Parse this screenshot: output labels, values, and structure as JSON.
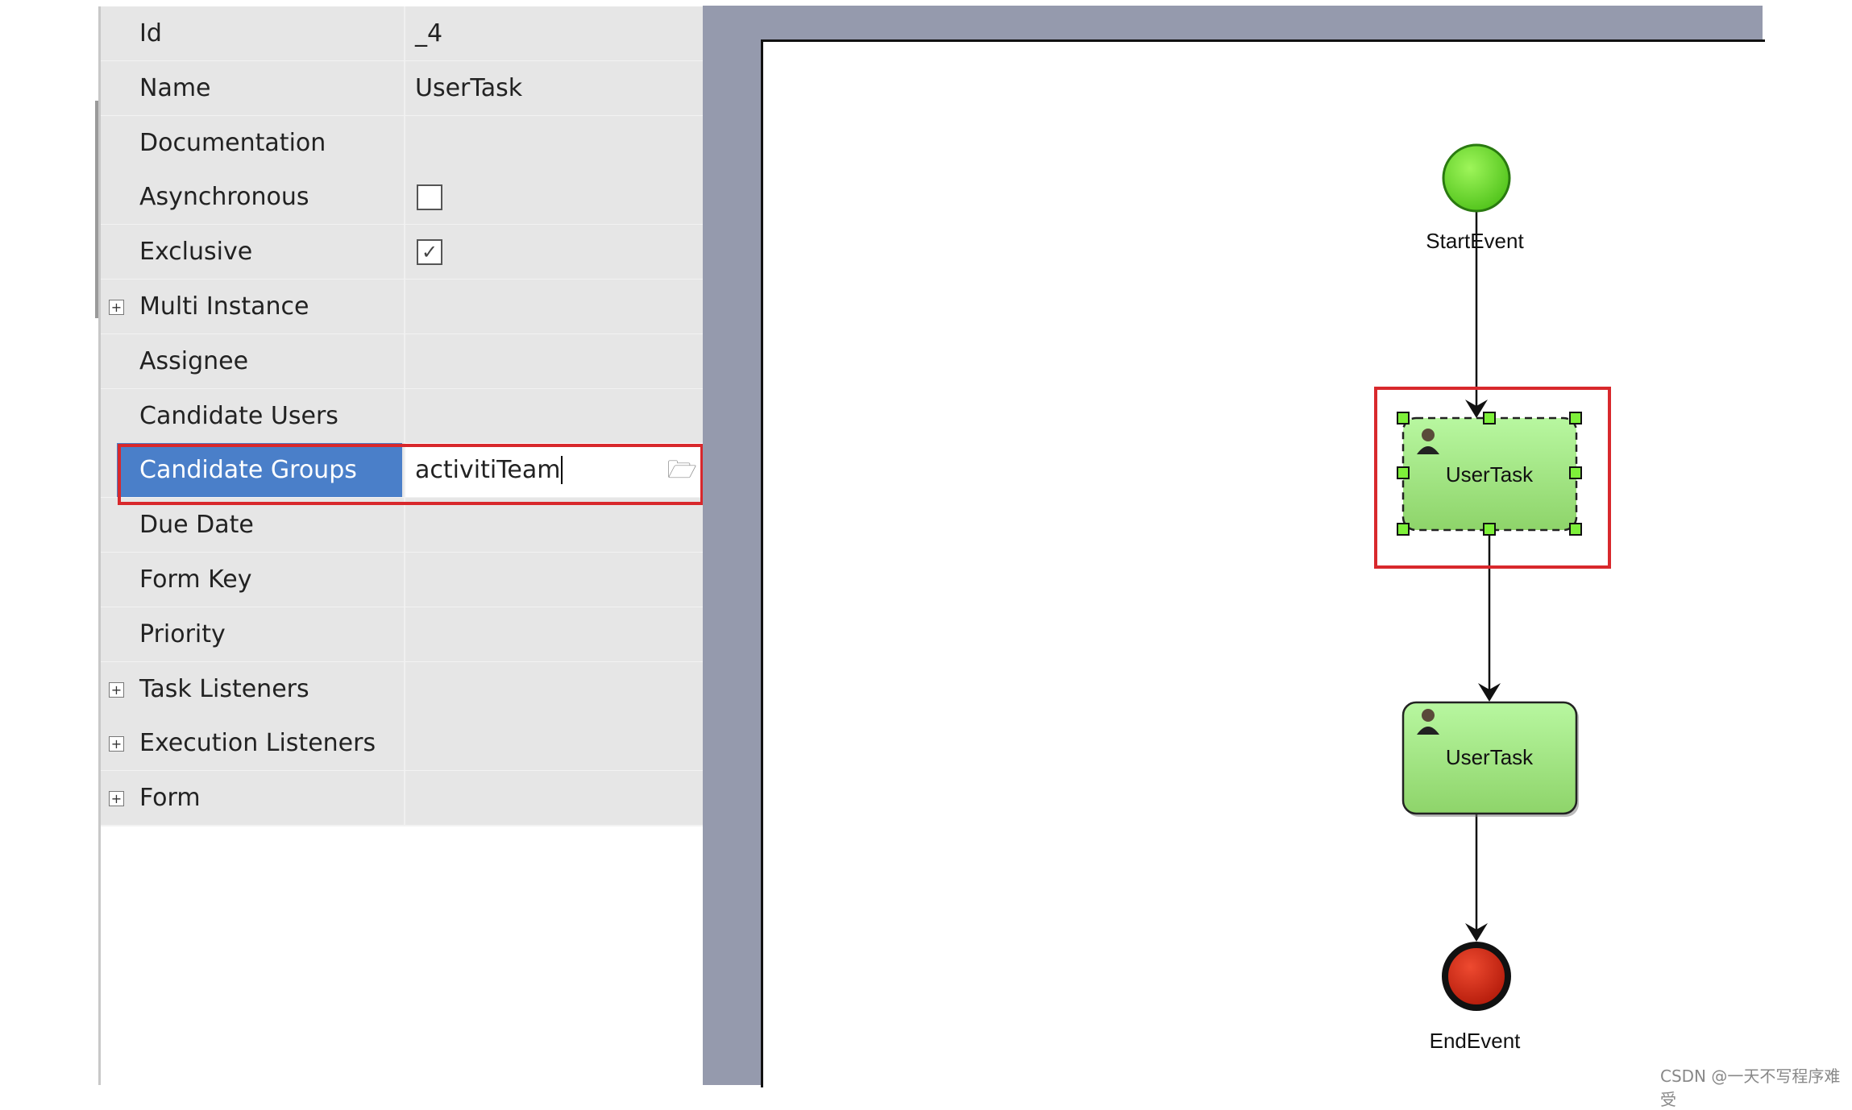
{
  "properties": [
    {
      "label": "Id",
      "value": "_4"
    },
    {
      "label": "Name",
      "value": "UserTask"
    },
    {
      "label": "Documentation",
      "value": ""
    },
    {
      "label": "Asynchronous",
      "checkbox": false
    },
    {
      "label": "Exclusive",
      "checkbox": true
    },
    {
      "label": "Multi Instance",
      "expandable": true
    },
    {
      "label": "Assignee",
      "value": ""
    },
    {
      "label": "Candidate Users",
      "value": ""
    },
    {
      "label": "Candidate Groups",
      "value": "activitiTeam",
      "selected": true
    },
    {
      "label": "Due Date",
      "value": ""
    },
    {
      "label": "Form Key",
      "value": ""
    },
    {
      "label": "Priority",
      "value": ""
    },
    {
      "label": "Task Listeners",
      "expandable": true
    },
    {
      "label": "Execution Listeners",
      "expandable": true
    },
    {
      "label": "Form",
      "expandable": true
    }
  ],
  "diagram": {
    "start_label": "StartEvent",
    "task1_label": "UserTask",
    "task2_label": "UserTask",
    "end_label": "EndEvent"
  },
  "colors": {
    "selection": "#4a7fc9",
    "highlight": "#d8282c",
    "task_fill": "#a8e88c",
    "start": "#6fdc2a",
    "end": "#d42010"
  },
  "watermark": "CSDN @一天不写程序难受"
}
